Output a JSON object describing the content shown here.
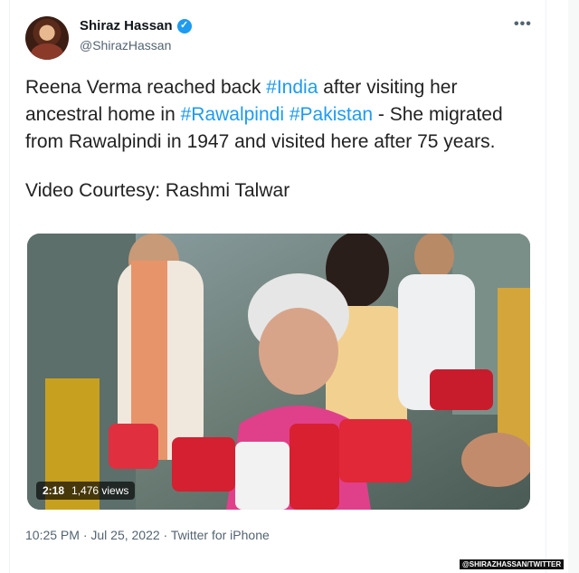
{
  "author": {
    "name": "Shiraz Hassan",
    "handle": "@ShirazHassan",
    "verified_icon": "verified-badge-icon"
  },
  "more_label": "•••",
  "tweet": {
    "p1": {
      "t1": "Reena Verma reached back ",
      "h1": "#India",
      "t2": " after visiting her ancestral home in ",
      "h2": "#Rawalpindi",
      "t3": " ",
      "h3": "#Pakistan",
      "t4": " - She migrated from Rawalpindi in 1947 and visited here after 75 years."
    },
    "p2": "Video Courtesy: Rashmi Talwar"
  },
  "video": {
    "duration": "2:18",
    "views": "1,476 views"
  },
  "meta": "10:25 PM · Jul 25, 2022 · Twitter for iPhone",
  "watermark": "@SHIRAZHASSAN/TWITTER",
  "colors": {
    "link": "#1d9bf0",
    "secondary": "#536471"
  }
}
